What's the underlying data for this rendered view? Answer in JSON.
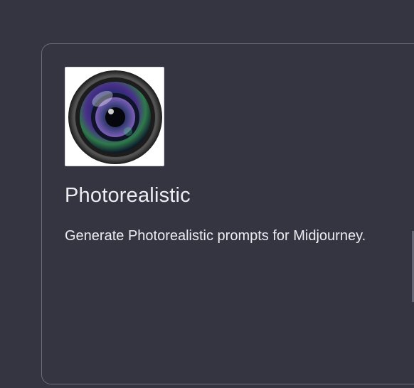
{
  "card": {
    "title": "Photorealistic",
    "description": "Generate Photorealistic prompts for Midjourney.",
    "image_icon": "camera-lens-icon"
  },
  "colors": {
    "background": "#343541",
    "card_border": "#6b6c7b",
    "text": "#ececf1"
  }
}
